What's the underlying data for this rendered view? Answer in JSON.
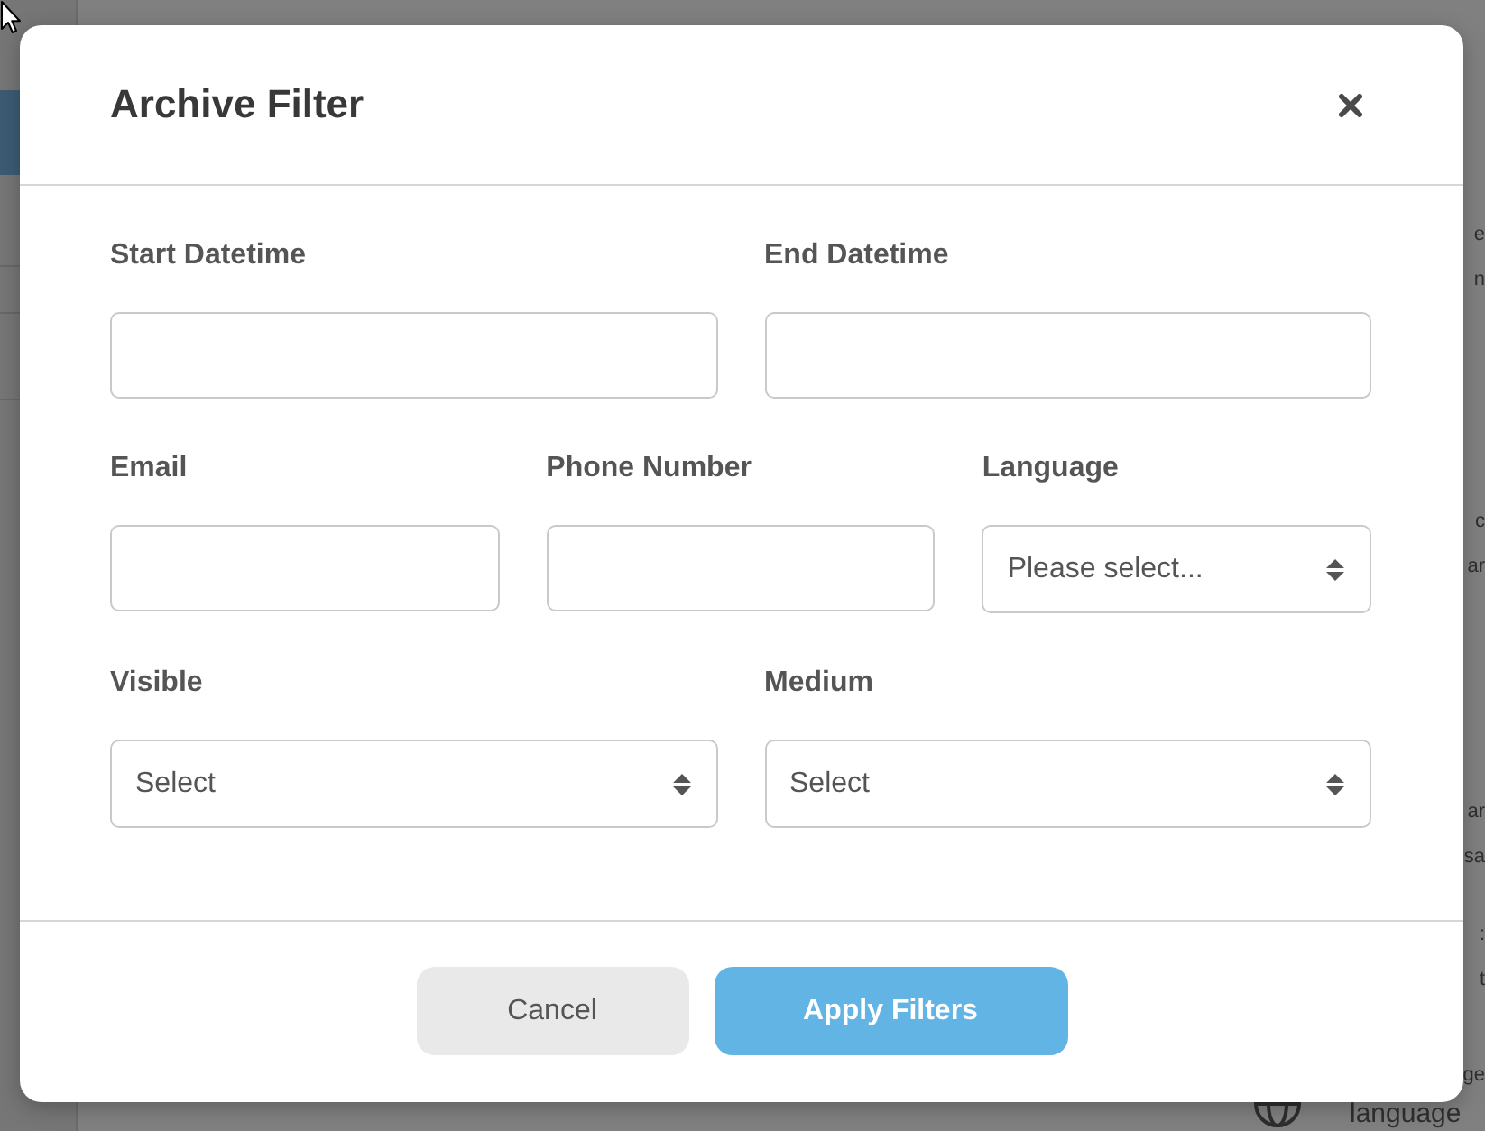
{
  "background": {
    "sidebar": {
      "items": [
        {
          "selected": true
        },
        {
          "selected": false
        },
        {
          "selected": false
        },
        {
          "selected": false
        }
      ]
    },
    "right_edge_lines": [
      [
        "e",
        "n"
      ],
      [
        "c",
        "ar"
      ],
      [
        "ar",
        "sa"
      ],
      [
        ":",
        "t"
      ],
      [
        "ge"
      ]
    ],
    "bottom_item": {
      "label": "language"
    }
  },
  "dialog": {
    "title": "Archive Filter",
    "rows": [
      [
        {
          "label": "Start Datetime",
          "kind": "text"
        },
        {
          "label": "End Datetime",
          "kind": "text"
        }
      ],
      [
        {
          "label": "Email",
          "kind": "text"
        },
        {
          "label": "Phone Number",
          "kind": "text"
        },
        {
          "label": "Language",
          "kind": "select",
          "placeholder": "Please select..."
        }
      ],
      [
        {
          "label": "Visible",
          "kind": "select",
          "placeholder": "Select"
        },
        {
          "label": "Medium",
          "kind": "select",
          "placeholder": "Select"
        }
      ]
    ],
    "buttons": [
      {
        "label": "Cancel",
        "kind": "secondary"
      },
      {
        "label": "Apply Filters",
        "kind": "primary"
      }
    ]
  }
}
